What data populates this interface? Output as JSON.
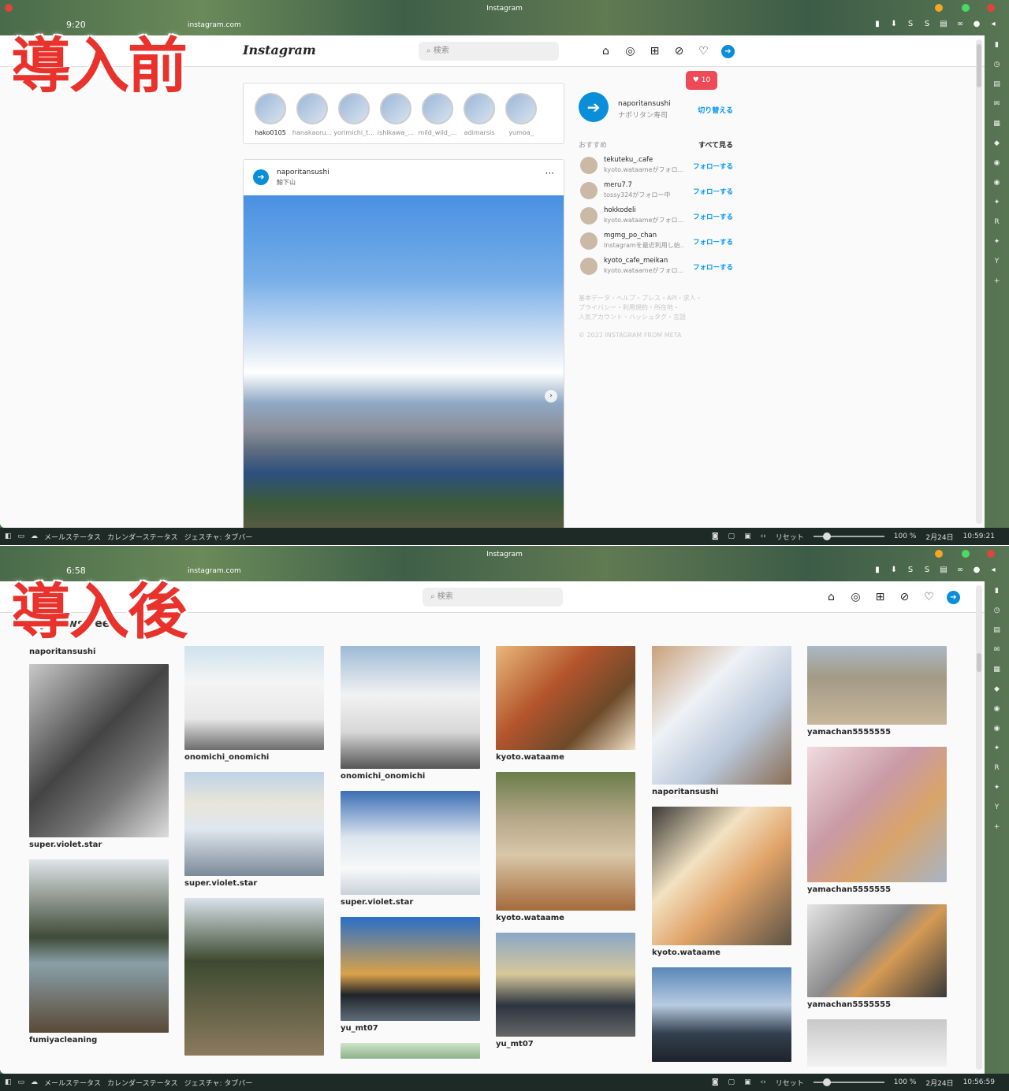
{
  "window": {
    "title": "Instagram",
    "url": "instagram.com"
  },
  "before": {
    "banner": "導入前",
    "time_partial": "9:20",
    "search_placeholder": "検索",
    "notif_count": "10",
    "stories": [
      "hako0105",
      "hanakaoru...",
      "yorimichi_t...",
      "ishikawa_...",
      "mild_wild_...",
      "adimarsis",
      "yumoa_"
    ],
    "post": {
      "user": "naporitansushi",
      "location": "鯨下山"
    },
    "profile": {
      "username": "naporitansushi",
      "name": "ナポリタン寿司",
      "switch": "切り替える"
    },
    "recommend_label": "おすすめ",
    "see_all": "すべて見る",
    "recommendations": [
      {
        "user": "tekuteku_.cafe",
        "sub": "kyoto.wataameがフォロ...",
        "action": "フォローする"
      },
      {
        "user": "meru7.7",
        "sub": "tossy324がフォロー中",
        "action": "フォローする"
      },
      {
        "user": "hokkodeli",
        "sub": "kyoto.wataameがフォロ...",
        "action": "フォローする"
      },
      {
        "user": "mgmg_po_chan",
        "sub": "Instagramを最近利用し始...",
        "action": "フォローする"
      },
      {
        "user": "kyoto_cafe_meikan",
        "sub": "kyoto.wataameがフォロ...",
        "action": "フォローする"
      }
    ],
    "footer_lines": [
      "基本データ・ヘルプ・プレス・API・求人・",
      "プライバシー・利用規約・所在地・",
      "人気アカウント・ハッシュタグ・言語"
    ],
    "copyright": "© 2022 INSTAGRAM FROM META",
    "status_time": "10:59:21"
  },
  "after": {
    "banner": "導入後",
    "time_partial": "6:58",
    "search_placeholder": "検索",
    "feed_title": "My News Feed",
    "feed_user": "naporitansushi",
    "columns": [
      [
        {
          "cap": "super.violet.star",
          "h": 220,
          "bg": "linear-gradient(135deg,#c8c8c8,#444 45%,#777 70%,#ddd)"
        },
        {
          "cap": "fumiyacleaning",
          "h": 220,
          "bg": "linear-gradient(180deg,#dfe5e8 0%,#3f4b38 45%,#89a0a8 60%,#5a4a38 100%)"
        }
      ],
      [
        {
          "cap": "onomichi_onomichi",
          "h": 132,
          "bg": "linear-gradient(180deg,#cfe2ef 0%,#f4f4f4 35%,#e8e8e8 70%,#6d6d6d 100%)"
        },
        {
          "cap": "super.violet.star",
          "h": 132,
          "bg": "linear-gradient(180deg,#bfd3e6 0%,#e8e5d9 30%,#dfe7ef 55%,#7b8a98 100%)"
        },
        {
          "cap": "",
          "h": 200,
          "bg": "linear-gradient(180deg,#d9e3ea 0%,#3d4a30 40%,#8b7a5f 100%)"
        }
      ],
      [
        {
          "cap": "onomichi_onomichi",
          "h": 156,
          "bg": "linear-gradient(180deg,#9dbad6 0%,#f2f2f2 40%,#d8d8d8 70%,#555 100%)"
        },
        {
          "cap": "super.violet.star",
          "h": 132,
          "bg": "linear-gradient(180deg,#3c6fb5 0%,#dde6ef 45%,#f8f8f8 75%,#c9d2da 100%)"
        },
        {
          "cap": "yu_mt07",
          "h": 132,
          "bg": "linear-gradient(180deg,#2a6fc9 0%,#d9a24a 55%,#20242a 75%,#5f6d7a 100%)"
        },
        {
          "cap": "",
          "h": 20,
          "bg": "linear-gradient(180deg,#cfe3c8,#8db38a)"
        }
      ],
      [
        {
          "cap": "kyoto.wataame",
          "h": 132,
          "bg": "linear-gradient(135deg,#e9b87a 0%,#b3542c 40%,#6d4a2a 70%,#f1e2c8 100%)"
        },
        {
          "cap": "kyoto.wataame",
          "h": 176,
          "bg": "linear-gradient(180deg,#6a7d4a 0%,#b7a98a 35%,#d9c7a8 60%,#a46a3a 100%)"
        },
        {
          "cap": "yu_mt07",
          "h": 132,
          "bg": "linear-gradient(180deg,#8aa7c8 0%,#d6c89a 40%,#2c3440 70%,#666 100%)"
        }
      ],
      [
        {
          "cap": "naporitansushi",
          "h": 176,
          "bg": "linear-gradient(135deg,#caa07a 0%,#eef2f7 35%,#b9c7d9 65%,#8a6d54 100%)"
        },
        {
          "cap": "kyoto.wataame",
          "h": 176,
          "bg": "linear-gradient(135deg,#3b3a36 0%,#f2e2c2 35%,#e0a268 60%,#5a5245 100%)"
        },
        {
          "cap": "",
          "h": 120,
          "bg": "linear-gradient(180deg,#5b86b8 0%,#b8cbe0 40%,#33404f 70%,#1e232b 100%)"
        }
      ],
      [
        {
          "cap": "yamachan5555555",
          "h": 100,
          "bg": "linear-gradient(180deg,#aab9c4 0%,#a39a86 40%,#c7b79c 100%)"
        },
        {
          "cap": "yamachan5555555",
          "h": 172,
          "bg": "linear-gradient(135deg,#f1dbe0 0%,#c89aa6 40%,#d9a46a 65%,#a7b4c4 100%)"
        },
        {
          "cap": "yamachan5555555",
          "h": 118,
          "bg": "linear-gradient(135deg,#e5e5e5 0%,#8a8a8a 45%,#d49a55 60%,#3a3a3a 100%)"
        },
        {
          "cap": "",
          "h": 60,
          "bg": "linear-gradient(180deg,#c8c8c8,#f2f2f2)"
        }
      ]
    ],
    "status_time": "10:56:59"
  },
  "statusbar": {
    "mail": "メールステータス",
    "calendar": "カレンダーステータス",
    "gesture": "ジェスチャ: タブバー",
    "reset": "リセット",
    "zoom": "100 %",
    "date": "2月24日"
  }
}
